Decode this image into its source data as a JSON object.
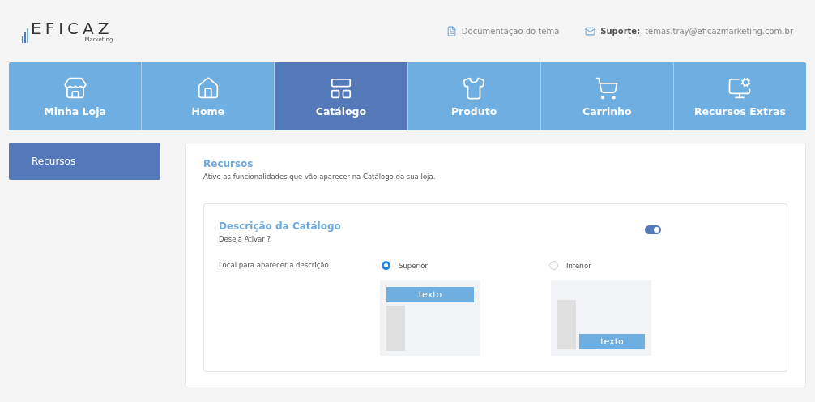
{
  "logo": {
    "name": "EFICAZ",
    "tagline": "Marketing"
  },
  "header_links": [
    {
      "label": "Documentação do tema"
    },
    {
      "label_bold": "Suporte:",
      "label": "temas.tray@eficazmarketing.com.br"
    }
  ],
  "tabs": [
    {
      "label": "Minha Loja",
      "selected": false
    },
    {
      "label": "Home",
      "selected": false
    },
    {
      "label": "Catálogo",
      "selected": true
    },
    {
      "label": "Produto",
      "selected": false
    },
    {
      "label": "Carrinho",
      "selected": false
    },
    {
      "label": "Recursos Extras",
      "selected": false
    }
  ],
  "sidebar": {
    "items": [
      {
        "label": "Recursos",
        "selected": true
      }
    ]
  },
  "section": {
    "title": "Recursos",
    "subtitle": "Ative as funcionalidades que vão aparecer na Catálogo da sua loja."
  },
  "feature": {
    "title": "Descrição da Catálogo",
    "subtitle": "Deseja Ativar ?",
    "on": true,
    "field_label": "Local para aparecer a descrição",
    "options": [
      {
        "label": "Superior",
        "selected": true,
        "kind": "top",
        "preview_text": "texto"
      },
      {
        "label": "Inferior",
        "selected": false,
        "kind": "bottom",
        "preview_text": "texto"
      }
    ]
  }
}
